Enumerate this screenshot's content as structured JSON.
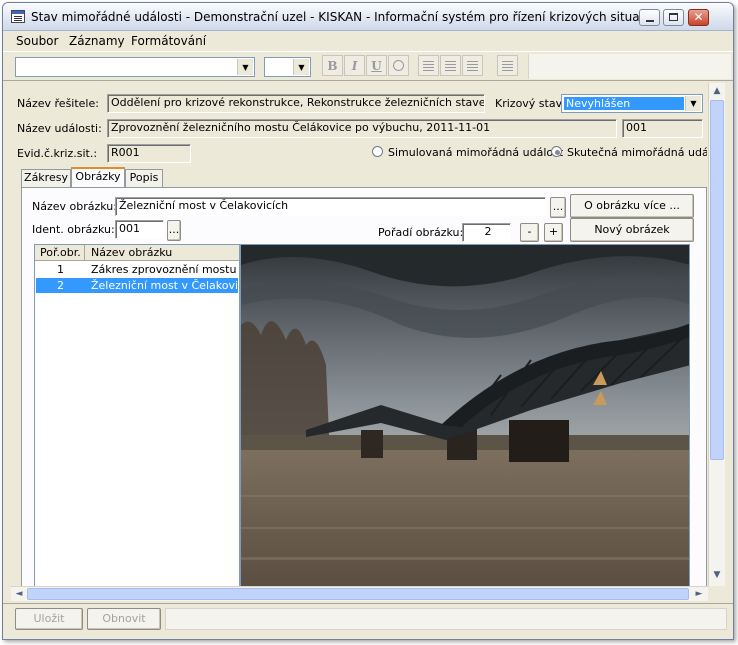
{
  "window": {
    "title": "Stav mimořádné události - Demonstrační uzel - KISKAN - Informační systém pro řízení krizových situací"
  },
  "menu": [
    "Soubor",
    "Záznamy",
    "Formátování"
  ],
  "toolbar": {
    "bold": "B",
    "italic": "I",
    "underline": "U"
  },
  "form": {
    "resitel_label": "Název řešitele:",
    "resitel_value": "Oddělení pro krizové rekonstrukce, Rekonstrukce železničních staveb, a. s.",
    "krizovy_stav_label": "Krizový stav:",
    "krizovy_stav_value": "Nevyhlášen",
    "udalost_label": "Název události:",
    "udalost_value": "Zprovoznění železničního mostu Čelákovice po výbuchu, 2011-11-01",
    "udalost_code": "001",
    "evid_label": "Evid.č.kriz.sit.:",
    "evid_value": "R001",
    "radio_simulovana": "Simulovaná mimořádná událost",
    "radio_skutecna": "Skutečná mimořádná událost"
  },
  "tabs": [
    "Zákresy",
    "Obrázky",
    "Popis"
  ],
  "obrazky": {
    "nazev_label": "Název obrázku:",
    "nazev_value": "Železniční most v Čelakovicích",
    "browse": "...",
    "o_obrazku_button": "O obrázku více ...",
    "ident_label": "Ident. obrázku:",
    "ident_value": "001",
    "poradi_label": "Pořadí obrázku:",
    "poradi_value": "2",
    "minus": "-",
    "plus": "+",
    "novy_button": "Nový obrázek",
    "list_headers": [
      "Poř.obr.",
      "Název obrázku"
    ],
    "list_rows": [
      {
        "num": "1",
        "name": "Zákres zprovoznění mostu Čelá"
      },
      {
        "num": "2",
        "name": "Železniční most v Čelakovicích"
      }
    ]
  },
  "footer": {
    "save": "Uložit",
    "refresh": "Obnovit"
  },
  "colors": {
    "selection": "#3399ff",
    "accent_tab": "#e68b2c"
  }
}
